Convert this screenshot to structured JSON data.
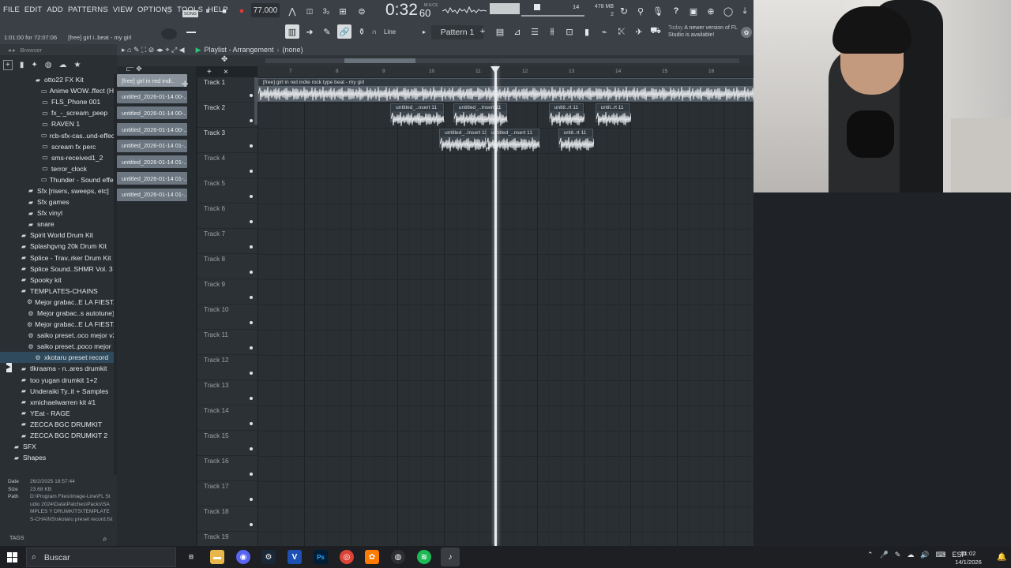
{
  "menu": [
    "FILE",
    "EDIT",
    "ADD",
    "PATTERNS",
    "VIEW",
    "OPTIONS",
    "TOOLS",
    "HELP"
  ],
  "transport": {
    "song_badge": "SONG",
    "bpm": "77.000",
    "time": "0:32",
    "time_sub": "60",
    "ms_label": "M:S:CS",
    "cpu_value": "14",
    "memory": "478 MB",
    "voices": "2"
  },
  "hint": {
    "position": "1:01:00 for 72:07:06",
    "project": "[free] girl i..beat - my girl"
  },
  "toolbar": {
    "snap": "Line",
    "pattern": "Pattern 1"
  },
  "news": {
    "label": "Today",
    "message": "A newer version of FL Studio is available!"
  },
  "browser": {
    "title": "Browser",
    "items": [
      {
        "label": "otto22 FX Kit",
        "indent": 3,
        "icon": "folder"
      },
      {
        "label": "Anime WOW..ffect (HD)",
        "indent": 4,
        "icon": "file"
      },
      {
        "label": "FLS_Phone 001",
        "indent": 4,
        "icon": "file"
      },
      {
        "label": "fx_-_scream_peep",
        "indent": 4,
        "icon": "file"
      },
      {
        "label": "RAVEN 1",
        "indent": 4,
        "icon": "file"
      },
      {
        "label": "rcb-sfx-cas..und-effects",
        "indent": 4,
        "icon": "file"
      },
      {
        "label": "scream fx perc",
        "indent": 4,
        "icon": "file"
      },
      {
        "label": "sms-received1_2",
        "indent": 4,
        "icon": "file"
      },
      {
        "label": "terror_clock",
        "indent": 4,
        "icon": "file"
      },
      {
        "label": "Thunder - Sound effect",
        "indent": 4,
        "icon": "file"
      },
      {
        "label": "Sfx [risers, sweeps, etc]",
        "indent": 2,
        "icon": "folder"
      },
      {
        "label": "Sfx games",
        "indent": 2,
        "icon": "folder"
      },
      {
        "label": "Sfx vinyl",
        "indent": 2,
        "icon": "folder"
      },
      {
        "label": "snare",
        "indent": 2,
        "icon": "folder"
      },
      {
        "label": "Spirit World Drum Kit",
        "indent": 1,
        "icon": "folder"
      },
      {
        "label": "Splashgvng 20k Drum Kit",
        "indent": 1,
        "icon": "folder"
      },
      {
        "label": "Splice - Trav..rker Drum Kit",
        "indent": 1,
        "icon": "folder"
      },
      {
        "label": "Splice Sound..SHMR Vol. 3",
        "indent": 1,
        "icon": "folder"
      },
      {
        "label": "Spooky kit",
        "indent": 1,
        "icon": "folder"
      },
      {
        "label": "TEMPLATES-CHAINS",
        "indent": 1,
        "icon": "folder"
      },
      {
        "label": "Mejor grabac..E LA FIESTA",
        "indent": 2,
        "icon": "preset"
      },
      {
        "label": "Mejor grabac..s autotune)",
        "indent": 2,
        "icon": "preset"
      },
      {
        "label": "Mejor grabac..E LA FIESTA",
        "indent": 2,
        "icon": "preset"
      },
      {
        "label": "saiko preset..oco mejor v2",
        "indent": 2,
        "icon": "preset"
      },
      {
        "label": "saiko preset..poco mejor",
        "indent": 2,
        "icon": "preset"
      },
      {
        "label": "xkotaru preset record",
        "indent": 3,
        "icon": "preset"
      },
      {
        "label": "tlkraama - n..ares drumkit",
        "indent": 1,
        "icon": "folder"
      },
      {
        "label": "too yugan drumkit 1+2",
        "indent": 1,
        "icon": "folder"
      },
      {
        "label": "Underaiki Ty..it + Samples",
        "indent": 1,
        "icon": "folder"
      },
      {
        "label": "xmichaelwarren kit #1",
        "indent": 1,
        "icon": "folder"
      },
      {
        "label": "YEat - RAGE",
        "indent": 1,
        "icon": "folder"
      },
      {
        "label": "ZECCA BGC DRUMKIT",
        "indent": 1,
        "icon": "folder"
      },
      {
        "label": "ZECCA BGC DRUMKIT 2",
        "indent": 1,
        "icon": "folder"
      },
      {
        "label": "SFX",
        "indent": 0,
        "icon": "folder"
      },
      {
        "label": "Shapes",
        "indent": 0,
        "icon": "folder"
      }
    ],
    "info": {
      "date_label": "Date",
      "date": "26/2/2025 18:57:44",
      "size_label": "Size",
      "size": "23.68 KB",
      "path_label": "Path",
      "path": "D:\\Program Files\\Image-Line\\FL Studio 2024\\Data\\Patches\\Packs\\SAMPLES Y DRUMKITS\\TEMPLATES-CHAINS\\xkotaru preset record.fst"
    },
    "tags": "TAGS"
  },
  "patterns": [
    "[free] girl in red indi..",
    "untitled_2026-01-14 00-..",
    "untitled_2026-01-14 00-..",
    "untitled_2026-01-14 00-..",
    "untitled_2026-01-14 01-..",
    "untitled_2026-01-14 01-..",
    "untitled_2026-01-14 01-..",
    "untitled_2026-01-14 01-.."
  ],
  "playlist": {
    "title": "Playlist - Arrangement",
    "breadcrumb": "(none)",
    "ruler": [
      "7",
      "8",
      "9",
      "10",
      "11",
      "12",
      "13",
      "14",
      "15",
      "16"
    ],
    "tracks": [
      "Track 1",
      "Track 2",
      "Track 3",
      "Track 4",
      "Track 5",
      "Track 6",
      "Track 7",
      "Track 8",
      "Track 9",
      "Track 10",
      "Track 11",
      "Track 12",
      "Track 13",
      "Track 14",
      "Track 15",
      "Track 16",
      "Track 17",
      "Track 18",
      "Track 19"
    ],
    "clips": [
      {
        "track": 0,
        "start": 6.0,
        "len": 10.7,
        "label": "[free] girl in red  indie rock type beat - my girl"
      },
      {
        "track": 1,
        "start": 8.85,
        "len": 1.15,
        "label": "untitled_..nsert 11"
      },
      {
        "track": 1,
        "start": 10.2,
        "len": 1.15,
        "label": "untitled_..Insert 11"
      },
      {
        "track": 1,
        "start": 12.25,
        "len": 0.75,
        "label": "untitl..rt 11"
      },
      {
        "track": 1,
        "start": 13.25,
        "len": 0.75,
        "label": "untit..rt 11"
      },
      {
        "track": 2,
        "start": 9.9,
        "len": 1.15,
        "label": "untitled_..Insert 11"
      },
      {
        "track": 2,
        "start": 10.9,
        "len": 1.15,
        "label": "untitled_..nsert 11"
      },
      {
        "track": 2,
        "start": 12.45,
        "len": 0.75,
        "label": "untit..rt 11"
      }
    ]
  },
  "taskbar": {
    "search": "Buscar",
    "lang": "ESP",
    "time": "01:02",
    "date": "14/1/2026"
  },
  "colors": {
    "accent_green": "#2fc27a",
    "record_red": "#e03a3a",
    "playhead": "#e9ecee"
  }
}
